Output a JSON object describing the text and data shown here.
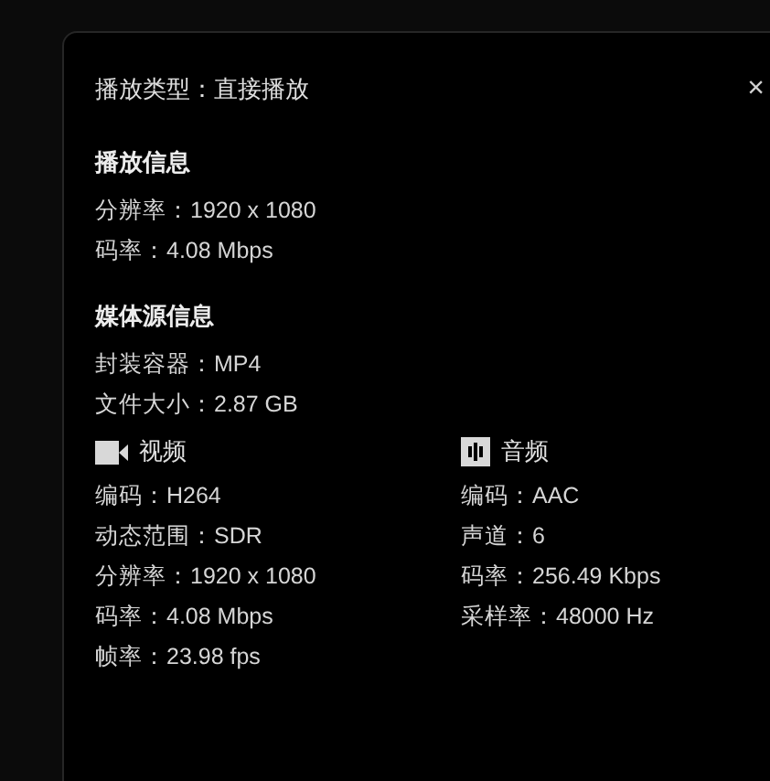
{
  "dialog": {
    "title": "播放类型：直接播放",
    "close": "×"
  },
  "playback_info": {
    "heading": "播放信息",
    "lines": [
      "分辨率：1920 x 1080",
      "码率：4.08 Mbps"
    ]
  },
  "media_info": {
    "heading": "媒体源信息",
    "lines": [
      "封装容器：MP4",
      "文件大小：2.87 GB"
    ],
    "streams": [
      {
        "kind": "video",
        "heading": "视频",
        "lines": [
          "编码：H264",
          "动态范围：SDR",
          "分辨率：1920 x 1080",
          "码率：4.08 Mbps",
          "帧率：23.98 fps"
        ]
      },
      {
        "kind": "audio",
        "heading": "音频",
        "lines": [
          "编码：AAC",
          "声道：6",
          "码率：256.49 Kbps",
          "采样率：48000 Hz"
        ]
      }
    ]
  }
}
